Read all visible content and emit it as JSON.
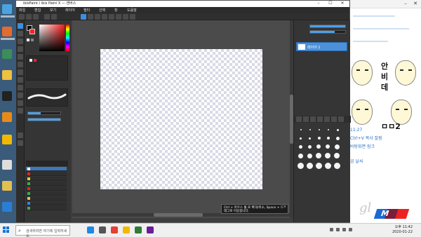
{
  "window": {
    "title": "ibisPaint / ibis Paint X — 캔버스",
    "minimize": "–",
    "maximize": "☐",
    "close": "✕"
  },
  "menu": [
    "파일",
    "편집",
    "보기",
    "레이어",
    "필터",
    "선택",
    "창",
    "도움말"
  ],
  "canvas": {
    "popup_text": "Ctrl + 마우스 휠 로 확대/축소, Space + 드래그로 이동합니다.",
    "popup_close": "×"
  },
  "layers_panel": {
    "active_layer": "레이어 1"
  },
  "browser": {
    "minimize": "–",
    "close": "✕",
    "kor_1": "안",
    "kor_2": "비",
    "kor_3": "데",
    "kor_4": "ㅁㅁ2",
    "chat": [
      "11:27",
      "Ctrl+V 복사 잘됨",
      "바탕화면 링크",
      "곰 날씨"
    ],
    "logo_text": "M",
    "sig": "gl"
  },
  "taskbar": {
    "search_placeholder": "검색하려면 여기에 입력하세요.",
    "time": "오후 11:42",
    "date": "2020-01-22"
  },
  "colors": {
    "accent": "#3c8ee0",
    "layer_selected": "#4c90d8",
    "app_bg": "#3e3e3e",
    "canvas_bg": "#4b4b4b"
  }
}
